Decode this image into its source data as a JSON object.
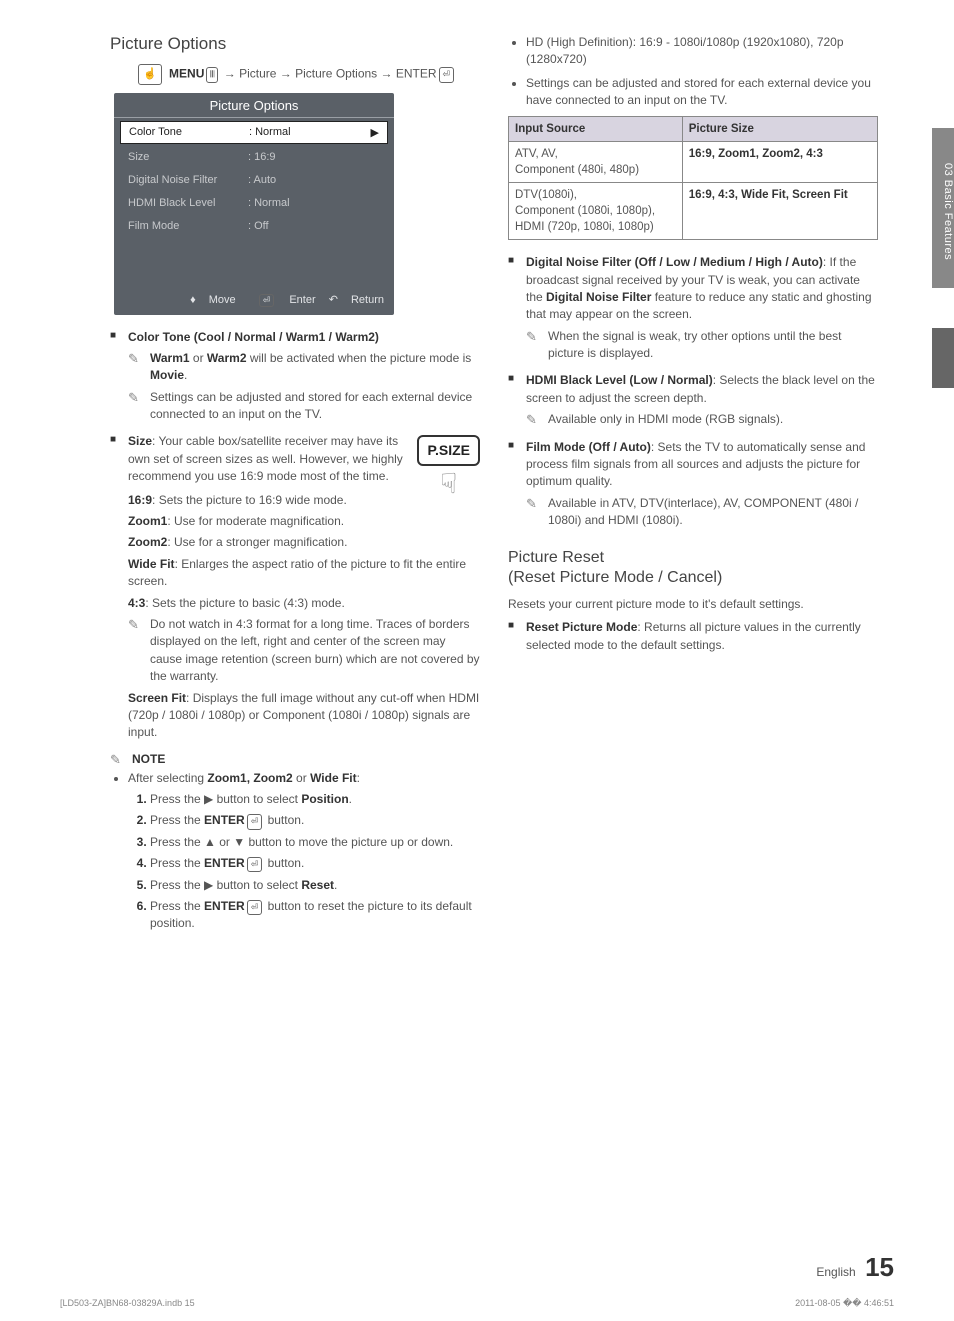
{
  "sideTab": "03  Basic Features",
  "left": {
    "title": "Picture Options",
    "menuPath1": "MENU",
    "menuPath2": " → Picture → Picture Options → ENTER",
    "osd": {
      "title": "Picture Options",
      "rows": [
        {
          "label": "Color Tone",
          "value": ": Normal",
          "selected": true
        },
        {
          "label": "Size",
          "value": ": 16:9"
        },
        {
          "label": "Digital Noise Filter",
          "value": ": Auto"
        },
        {
          "label": "HDMI Black Level",
          "value": ": Normal"
        },
        {
          "label": "Film Mode",
          "value": ": Off"
        }
      ],
      "footer": {
        "move": "Move",
        "enter": "Enter",
        "return": "Return"
      }
    },
    "colorTone": {
      "heading": "Color Tone (Cool / Normal / Warm1 / Warm2)",
      "note1a": "Warm1",
      "note1b": " or ",
      "note1c": "Warm2",
      "note1d": " will be activated when the picture mode is ",
      "note1e": "Movie",
      "note1f": ".",
      "note2": "Settings can be adjusted and stored for each external device connected to an input on the TV."
    },
    "size": {
      "headingLabel": "Size",
      "headingRest": ": Your cable box/satellite receiver may have its own set of screen sizes as well. However, we highly recommend you use 16:9 mode most of the time.",
      "items": [
        {
          "label": "16:9",
          "text": ": Sets the picture to 16:9 wide mode."
        },
        {
          "label": "Zoom1",
          "text": ": Use for moderate magnification."
        },
        {
          "label": "Zoom2",
          "text": ": Use for a stronger magnification."
        },
        {
          "label": "Wide Fit",
          "text": ": Enlarges the aspect ratio of the picture to fit the entire screen."
        },
        {
          "label": "4:3",
          "text": ": Sets the picture to basic (4:3) mode."
        }
      ],
      "note43": "Do not watch in 4:3 format for a long time. Traces of borders displayed on the left, right and center of the screen may cause image retention (screen burn) which are not covered by the warranty.",
      "screenFitLabel": "Screen Fit",
      "screenFitText": ": Displays the full image without any cut-off when HDMI (720p / 1080i / 1080p) or Component (1080i / 1080p) signals are input."
    },
    "noteHead": "NOTE",
    "noteAfter": "After selecting ",
    "noteAfterBold": "Zoom1, Zoom2",
    "noteAfterOr": " or ",
    "noteAfterWide": "Wide Fit",
    "noteAfterColon": ":",
    "steps": [
      {
        "pre": "Press the ▶ button to select ",
        "bold": "Position",
        "post": "."
      },
      {
        "pre": "Press the ",
        "bold": "ENTER",
        "post": " button."
      },
      {
        "pre": "Press the ▲ or ▼ button to move the picture up or down."
      },
      {
        "pre": "Press the ",
        "bold": "ENTER",
        "post": " button."
      },
      {
        "pre": "Press the ▶ button to select ",
        "bold": "Reset",
        "post": "."
      },
      {
        "pre": "Press the ",
        "bold": "ENTER",
        "post": " button to reset the picture to its default position."
      }
    ],
    "psize": "P.SIZE"
  },
  "right": {
    "topBullets": [
      "HD (High Definition): 16:9 - 1080i/1080p (1920x1080), 720p (1280x720)",
      "Settings can be adjusted and stored for each external device you have connected to an input on the TV."
    ],
    "table": {
      "h1": "Input Source",
      "h2": "Picture Size",
      "r1c1": "ATV, AV,\nComponent (480i, 480p)",
      "r1c2": "16:9, Zoom1, Zoom2, 4:3",
      "r2c1": "DTV(1080i),\nComponent (1080i, 1080p),\nHDMI (720p, 1080i, 1080p)",
      "r2c2": "16:9, 4:3, Wide Fit, Screen Fit"
    },
    "dnf": {
      "heading": "Digital Noise Filter (Off / Low / Medium / High / Auto)",
      "body": ": If the broadcast signal received by your TV is weak, you can activate the ",
      "bold": "Digital Noise Filter",
      "body2": " feature to reduce any static and ghosting that may appear on the screen.",
      "note": "When the signal is weak, try other options until the best picture is displayed."
    },
    "hdmi": {
      "heading": "HDMI Black Level (Low / Normal)",
      "body": ": Selects the black level on the screen to adjust the screen depth.",
      "note": "Available only in HDMI mode (RGB signals)."
    },
    "film": {
      "heading": "Film Mode (Off / Auto)",
      "body": ": Sets the TV to automatically sense and process film signals from all sources and adjusts the picture for optimum quality.",
      "note": "Available in ATV, DTV(interlace), AV, COMPONENT (480i / 1080i) and HDMI (1080i)."
    },
    "reset": {
      "title1": "Picture Reset",
      "title2": "(Reset Picture Mode / Cancel)",
      "intro": "Resets your current picture mode to it's default settings.",
      "itemLabel": "Reset Picture Mode",
      "itemText": ": Returns all picture values in the currently selected mode to the default settings."
    }
  },
  "footer": {
    "lang": "English",
    "page": "15",
    "leftPrint": "[LD503-ZA]BN68-03829A.indb   15",
    "rightPrint": "2011-08-05   �� 4:46:51"
  }
}
